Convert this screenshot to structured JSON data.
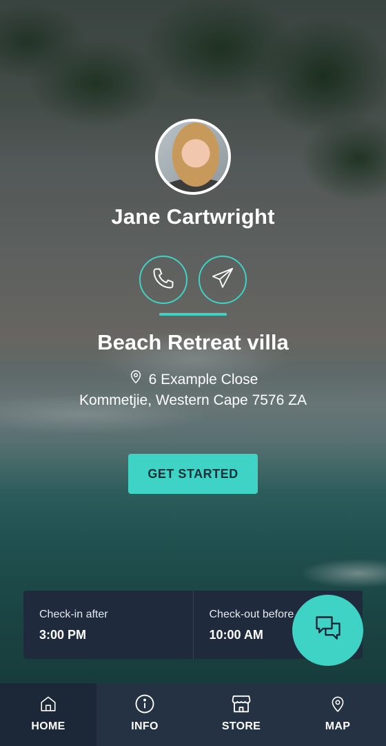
{
  "host": {
    "name": "Jane Cartwright"
  },
  "contact": {
    "phone_icon": "phone-icon",
    "message_icon": "send-icon"
  },
  "property": {
    "title": "Beach Retreat villa",
    "address_line1": "6 Example Close",
    "address_line2": "Kommetjie, Western Cape 7576 ZA",
    "location_icon": "map-pin-icon"
  },
  "cta": {
    "label": "GET STARTED"
  },
  "times": {
    "checkin_label": "Check-in after",
    "checkin_value": "3:00 PM",
    "checkout_label": "Check-out before",
    "checkout_value": "10:00 AM"
  },
  "chat": {
    "icon": "chat-bubbles-icon"
  },
  "nav": {
    "items": [
      {
        "label": "HOME",
        "icon": "home-icon",
        "active": true
      },
      {
        "label": "INFO",
        "icon": "info-icon",
        "active": false
      },
      {
        "label": "STORE",
        "icon": "store-icon",
        "active": false
      },
      {
        "label": "MAP",
        "icon": "map-pin-icon",
        "active": false
      }
    ]
  },
  "colors": {
    "accent": "#3fd3c5",
    "panel": "#1f2b3d",
    "nav": "#243244",
    "nav_active": "#1c2838"
  }
}
